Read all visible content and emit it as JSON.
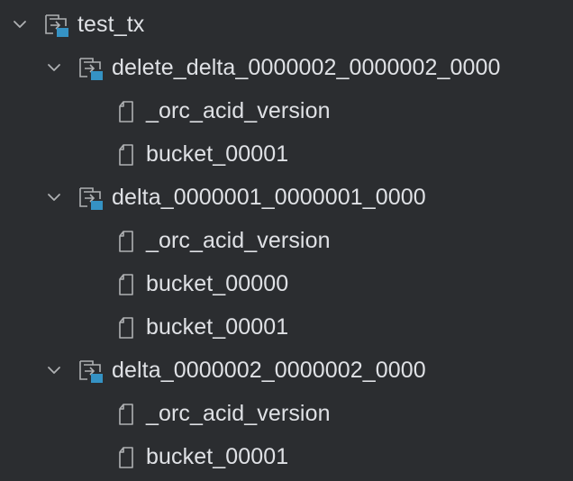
{
  "tree": {
    "root": {
      "label": "test_tx",
      "icon": "folder-module-icon",
      "expanded": true
    },
    "folders": [
      {
        "label": "delete_delta_0000002_0000002_0000",
        "icon": "folder-module-icon",
        "expanded": true,
        "files": [
          {
            "label": "_orc_acid_version",
            "icon": "file-icon"
          },
          {
            "label": "bucket_00001",
            "icon": "file-icon"
          }
        ]
      },
      {
        "label": "delta_0000001_0000001_0000",
        "icon": "folder-module-icon",
        "expanded": true,
        "files": [
          {
            "label": "_orc_acid_version",
            "icon": "file-icon"
          },
          {
            "label": "bucket_00000",
            "icon": "file-icon"
          },
          {
            "label": "bucket_00001",
            "icon": "file-icon"
          }
        ]
      },
      {
        "label": "delta_0000002_0000002_0000",
        "icon": "folder-module-icon",
        "expanded": true,
        "files": [
          {
            "label": "_orc_acid_version",
            "icon": "file-icon"
          },
          {
            "label": "bucket_00001",
            "icon": "file-icon"
          }
        ]
      }
    ]
  },
  "colors": {
    "background": "#2b2d30",
    "text": "#dfe1e5",
    "icon_stroke": "#afb1b3",
    "module_badge": "#3592c4"
  }
}
